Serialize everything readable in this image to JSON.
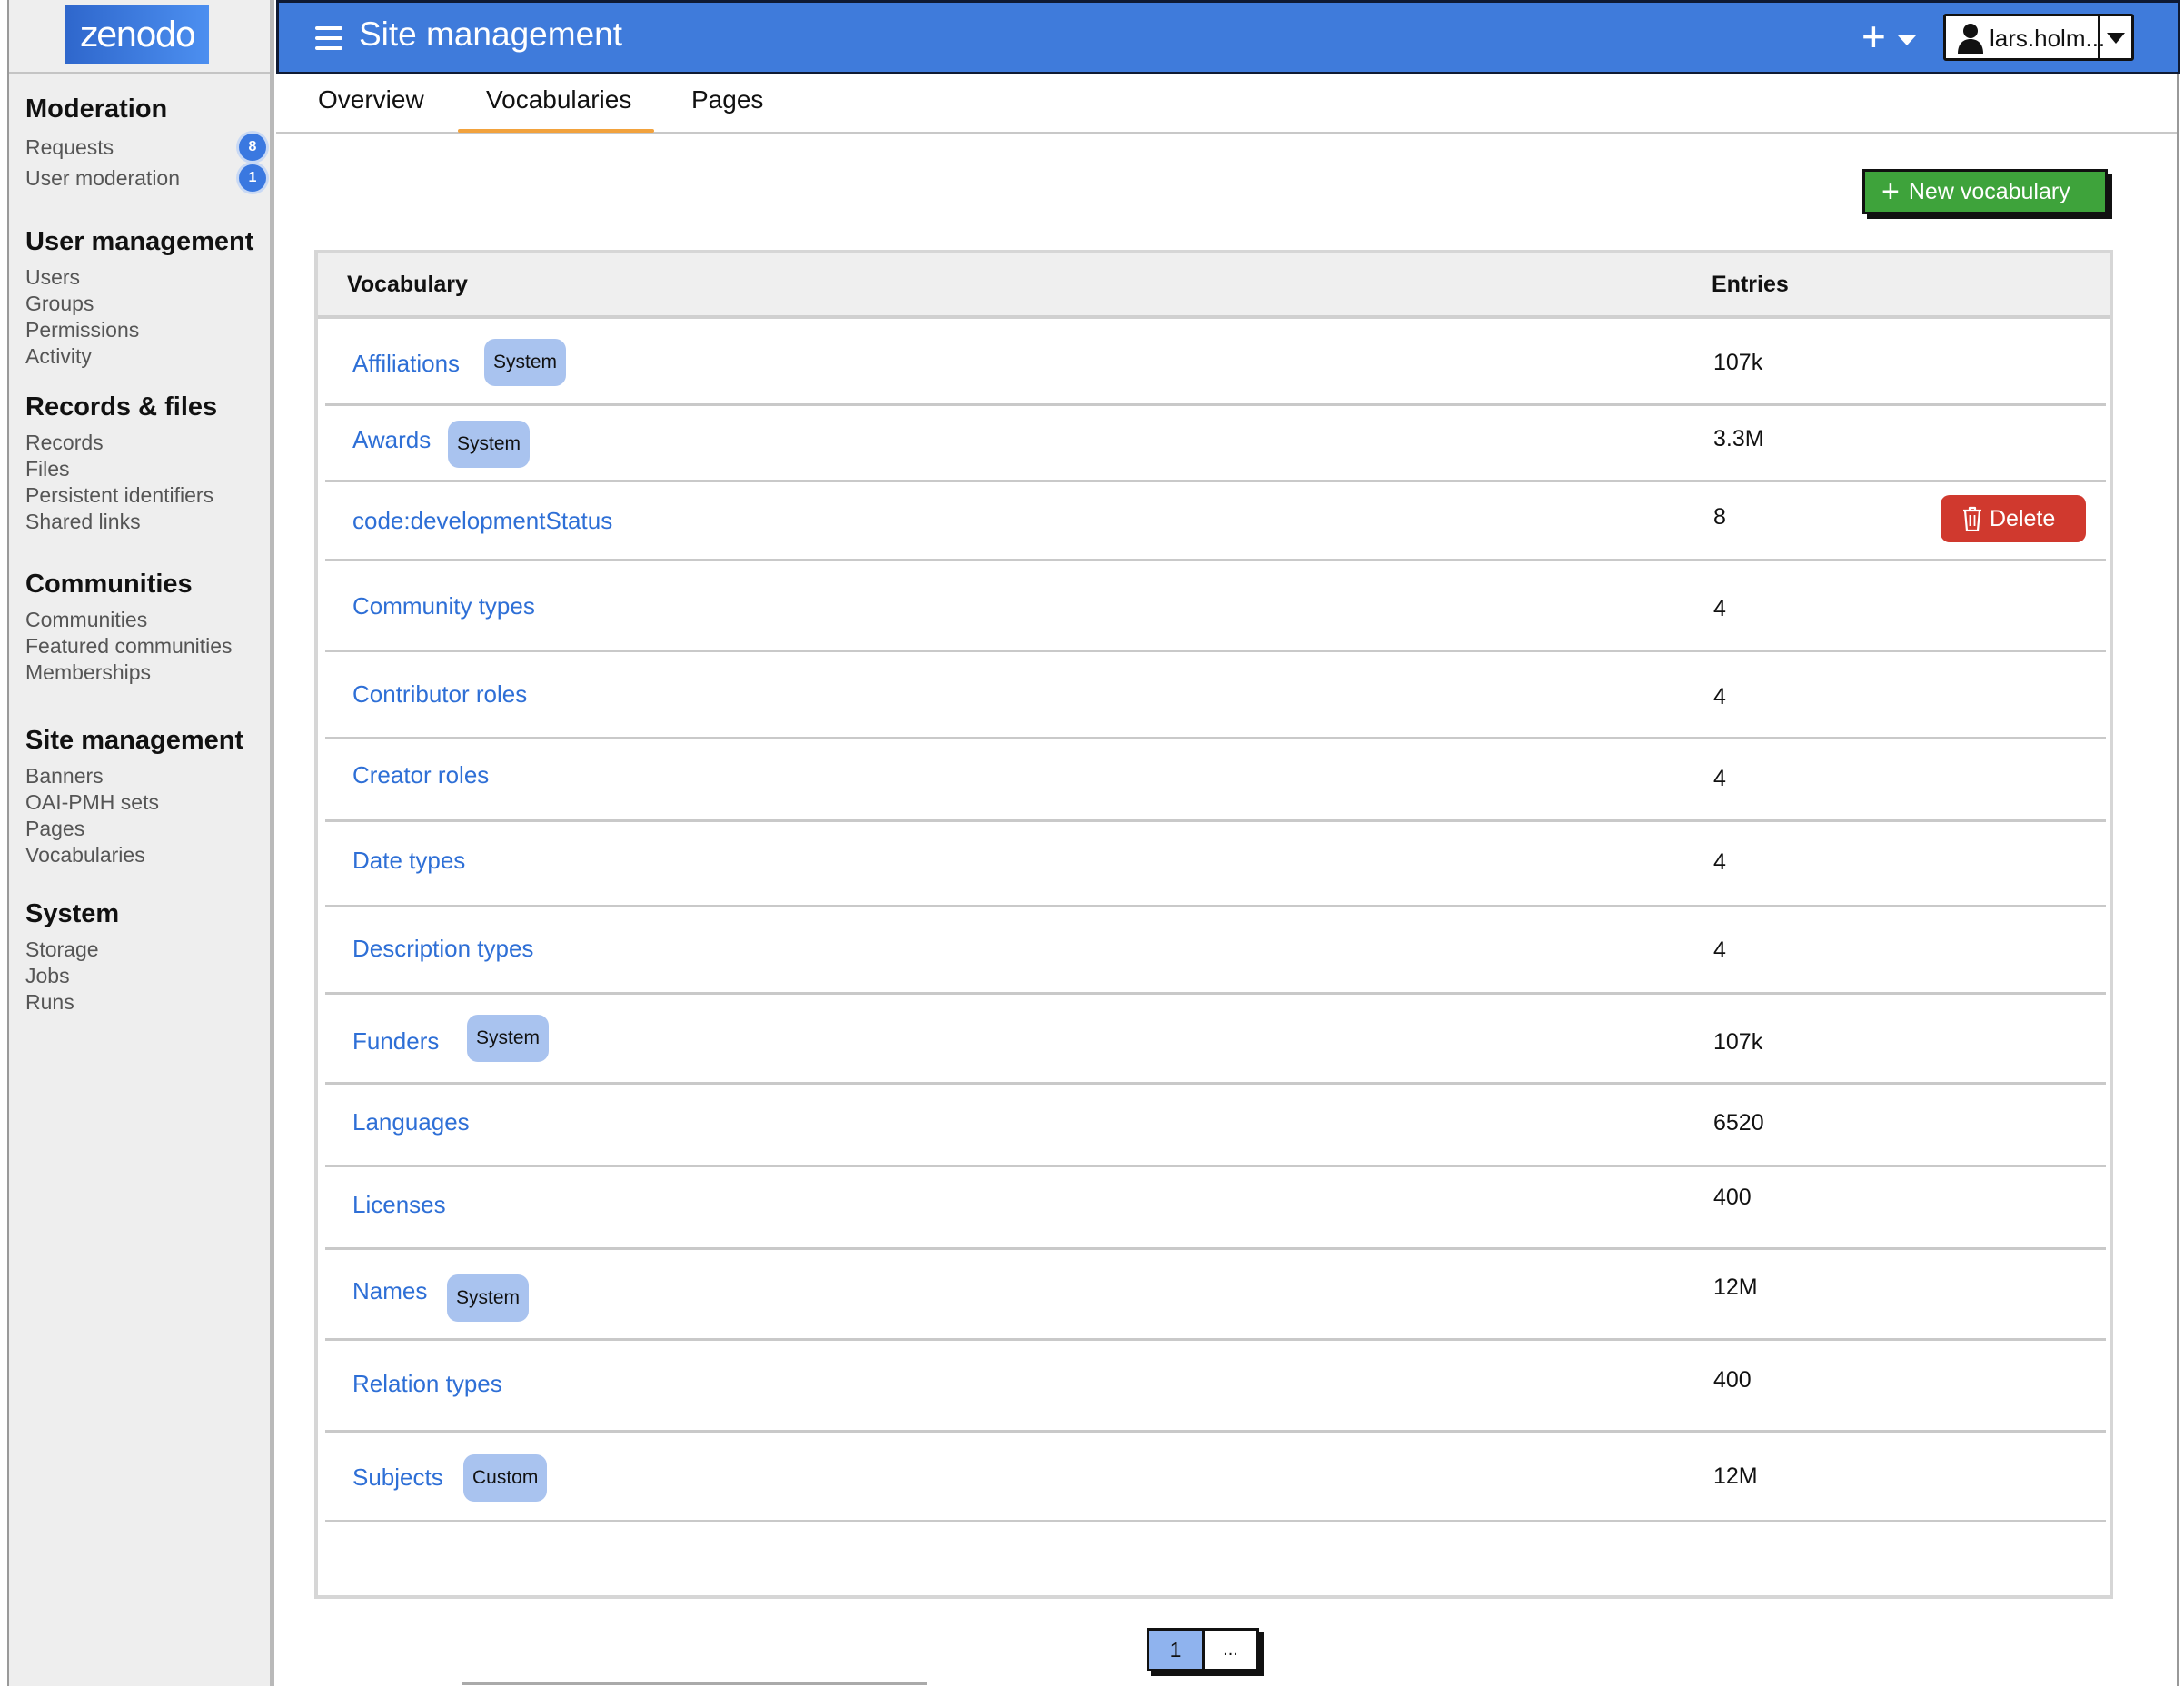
{
  "logo": {
    "text": "zenodo"
  },
  "sidebar": {
    "sections": [
      {
        "title": "Moderation",
        "items": [
          {
            "label": "Requests",
            "badge": "8"
          },
          {
            "label": "User moderation",
            "badge": "1"
          }
        ]
      },
      {
        "title": "User management",
        "items": [
          {
            "label": "Users"
          },
          {
            "label": "Groups"
          },
          {
            "label": "Permissions"
          },
          {
            "label": "Activity"
          }
        ]
      },
      {
        "title": "Records & files",
        "items": [
          {
            "label": "Records"
          },
          {
            "label": "Files"
          },
          {
            "label": "Persistent identifiers"
          },
          {
            "label": "Shared links"
          }
        ]
      },
      {
        "title": "Communities",
        "items": [
          {
            "label": "Communities"
          },
          {
            "label": "Featured communities"
          },
          {
            "label": "Memberships"
          }
        ]
      },
      {
        "title": "Site management",
        "items": [
          {
            "label": "Banners"
          },
          {
            "label": "OAI-PMH sets"
          },
          {
            "label": "Pages"
          },
          {
            "label": "Vocabularies"
          }
        ]
      },
      {
        "title": "System",
        "items": [
          {
            "label": "Storage"
          },
          {
            "label": "Jobs"
          },
          {
            "label": "Runs"
          }
        ]
      }
    ]
  },
  "header": {
    "title": "Site management",
    "plus_icon": "plus-icon",
    "user": {
      "name": "lars.holm..."
    }
  },
  "tabs": {
    "items": [
      {
        "label": "Overview"
      },
      {
        "label": "Vocabularies"
      },
      {
        "label": "Pages"
      }
    ],
    "active": "Vocabularies"
  },
  "toolbar": {
    "new_vocabulary_label": "New vocabulary"
  },
  "table": {
    "columns": {
      "vocabulary": "Vocabulary",
      "entries": "Entries"
    },
    "rows": [
      {
        "name": "Affiliations",
        "tag": "System",
        "entries": "107k"
      },
      {
        "name": "Awards",
        "tag": "System",
        "entries": "3.3M"
      },
      {
        "name": "code:developmentStatus",
        "entries": "8",
        "delete_label": "Delete"
      },
      {
        "name": "Community types",
        "entries": "4"
      },
      {
        "name": "Contributor roles",
        "entries": "4"
      },
      {
        "name": "Creator roles",
        "entries": "4"
      },
      {
        "name": "Date types",
        "entries": "4"
      },
      {
        "name": "Description types",
        "entries": "4"
      },
      {
        "name": "Funders",
        "tag": "System",
        "entries": "107k"
      },
      {
        "name": "Languages",
        "entries": "6520"
      },
      {
        "name": "Licenses",
        "entries": "400"
      },
      {
        "name": "Names",
        "tag": "System",
        "entries": "12M"
      },
      {
        "name": "Relation types",
        "entries": "400"
      },
      {
        "name": "Subjects",
        "tag": "Custom",
        "entries": "12M"
      }
    ]
  },
  "pagination": {
    "current": "1",
    "more": "..."
  },
  "colors": {
    "header_bg": "#3f7bdb",
    "link": "#2e6fd6",
    "primary_green": "#3ea33b",
    "danger": "#d0392e",
    "tag_bg": "#a9c3ef",
    "tab_accent": "#f2a23d"
  }
}
